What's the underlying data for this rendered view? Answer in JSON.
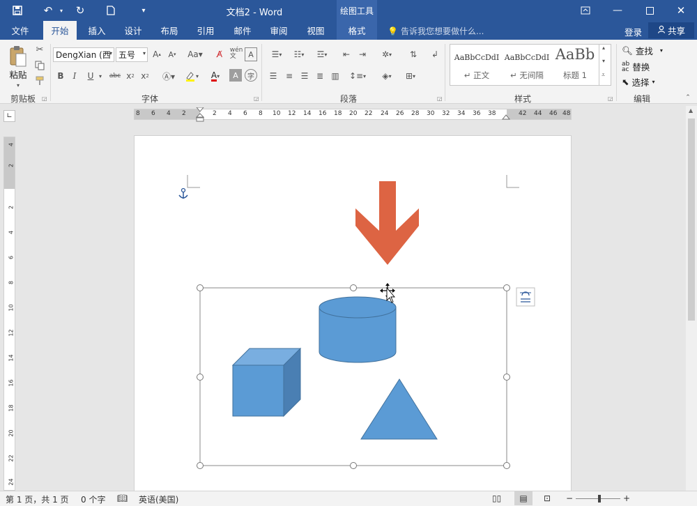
{
  "titlebar": {
    "title": "文档2 - Word",
    "context_group": "绘图工具"
  },
  "tabs": [
    {
      "label": "文件",
      "state": "normal"
    },
    {
      "label": "开始",
      "state": "active"
    },
    {
      "label": "插入",
      "state": "normal"
    },
    {
      "label": "设计",
      "state": "normal"
    },
    {
      "label": "布局",
      "state": "normal"
    },
    {
      "label": "引用",
      "state": "normal"
    },
    {
      "label": "邮件",
      "state": "normal"
    },
    {
      "label": "审阅",
      "state": "normal"
    },
    {
      "label": "视图",
      "state": "normal"
    },
    {
      "label": "格式",
      "state": "context"
    }
  ],
  "tellme": "告诉我您想要做什么...",
  "account": {
    "login": "登录",
    "share": "共享"
  },
  "ribbon": {
    "clipboard": {
      "paste": "粘贴",
      "group": "剪贴板"
    },
    "font": {
      "name": "DengXian (西",
      "size": "五号",
      "group": "字体"
    },
    "paragraph": {
      "group": "段落"
    },
    "styles": {
      "group": "样式",
      "items": [
        {
          "preview": "AaBbCcDdI",
          "name": "正文"
        },
        {
          "preview": "AaBbCcDdI",
          "name": "无间隔"
        },
        {
          "preview": "AaBb",
          "name": "标题 1"
        }
      ]
    },
    "editing": {
      "find": "查找",
      "replace": "替换",
      "select": "选择",
      "group": "编辑"
    }
  },
  "ruler": {
    "h_left": [
      "8",
      "6",
      "4",
      "2"
    ],
    "h_right": [
      "2",
      "4",
      "6",
      "8",
      "10",
      "12",
      "14",
      "16",
      "18",
      "20",
      "22",
      "24",
      "26",
      "28",
      "30",
      "32",
      "34",
      "36",
      "38",
      "42",
      "44",
      "46",
      "48"
    ],
    "v_top": [
      "4",
      "2"
    ],
    "v_body": [
      "2",
      "4",
      "6",
      "8",
      "10",
      "12",
      "14",
      "16",
      "18",
      "20",
      "22",
      "24"
    ]
  },
  "shapes": {
    "arrow_color": "#dd6443",
    "shape_fill": "#5b9bd5",
    "shape_dark": "#4a7fb3",
    "shape_light": "#79aee0",
    "shape_stroke": "#41719c"
  },
  "status": {
    "page": "第 1 页，共 1 页",
    "words": "0 个字",
    "language": "英语(美国)"
  }
}
